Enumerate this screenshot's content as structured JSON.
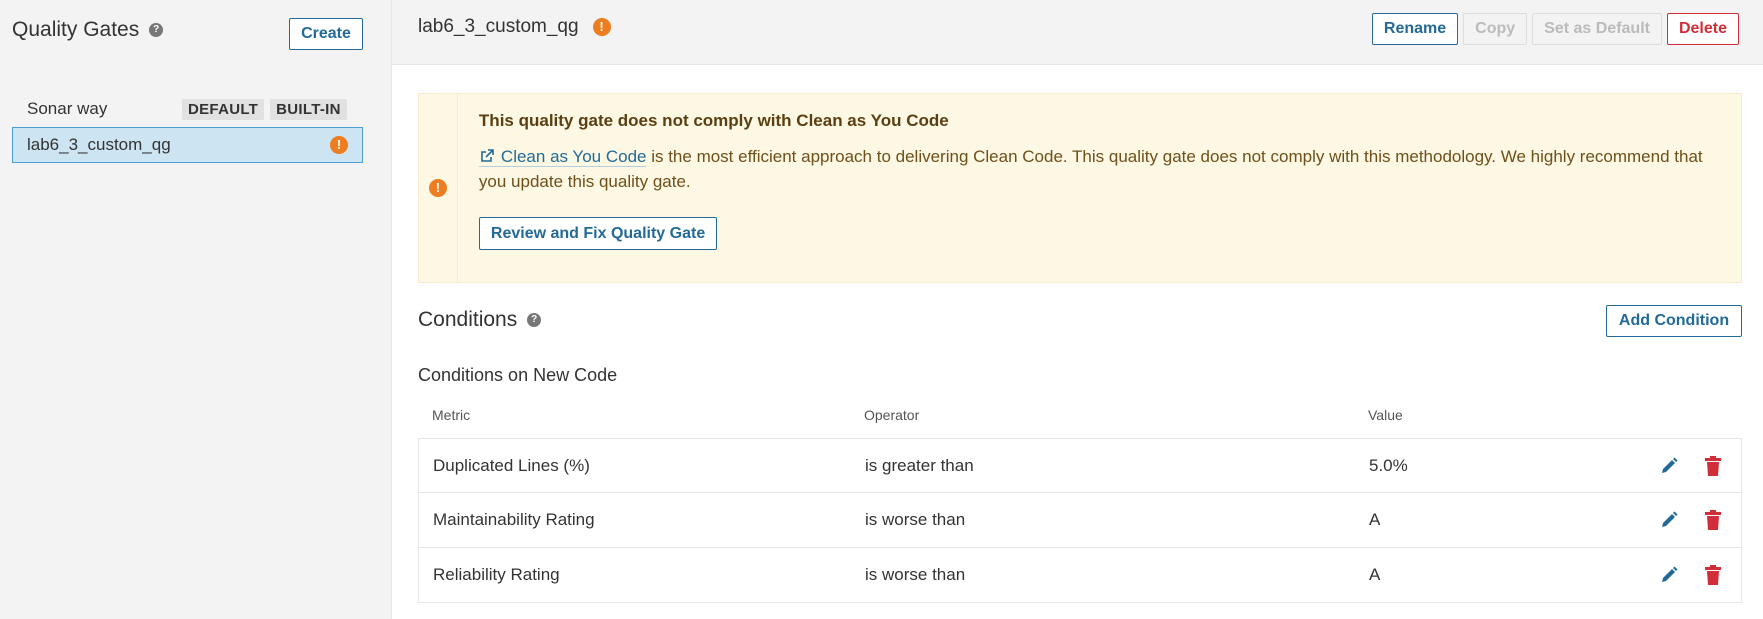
{
  "sidebar": {
    "title": "Quality Gates",
    "help_icon": "help-circle-icon",
    "create_label": "Create",
    "gates": [
      {
        "name": "Sonar way",
        "badges": [
          "DEFAULT",
          "BUILT-IN"
        ]
      },
      {
        "name": "lab6_3_custom_qg",
        "warning_icon": "warning-circle-icon"
      }
    ]
  },
  "header": {
    "gate_name": "lab6_3_custom_qg",
    "actions": {
      "rename": "Rename",
      "copy": "Copy",
      "set_default": "Set as Default",
      "delete": "Delete"
    }
  },
  "banner": {
    "title": "This quality gate does not comply with Clean as You Code",
    "link_text": "Clean as You Code",
    "text": " is the most efficient approach to delivering Clean Code. This quality gate does not comply with this methodology. We highly recommend that you update this quality gate.",
    "button": "Review and Fix Quality Gate"
  },
  "conditions": {
    "title": "Conditions",
    "add_label": "Add Condition",
    "new_code_title": "Conditions on New Code",
    "columns": [
      "Metric",
      "Operator",
      "Value"
    ],
    "rows": [
      {
        "metric": "Duplicated Lines (%)",
        "operator": "is greater than",
        "value": "5.0%"
      },
      {
        "metric": "Maintainability Rating",
        "operator": "is worse than",
        "value": "A"
      },
      {
        "metric": "Reliability Rating",
        "operator": "is worse than",
        "value": "A"
      }
    ]
  },
  "colors": {
    "accent": "#236a97",
    "warning": "#ed7d20",
    "danger": "#d02f3a",
    "selected_bg": "#cde4f3",
    "banner_bg": "#fcf8e3"
  }
}
